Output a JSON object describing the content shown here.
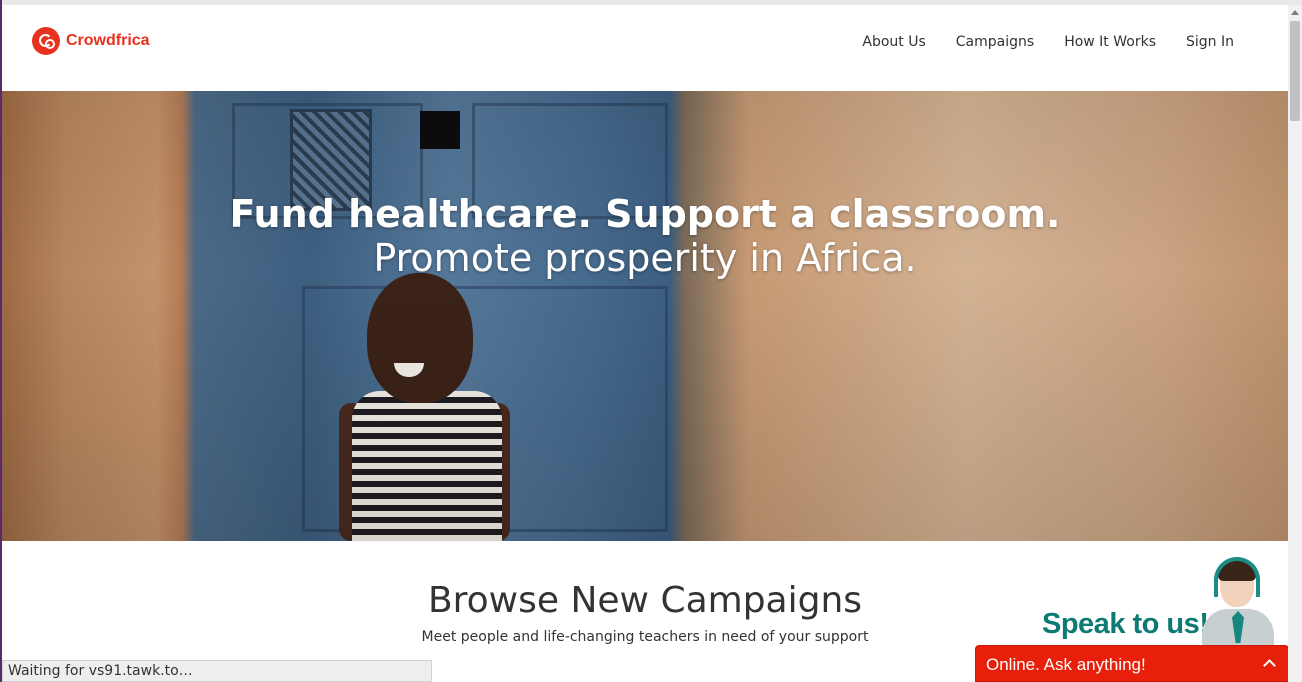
{
  "brand": {
    "name": "Crowdfrica",
    "accent_color": "#e8321f"
  },
  "nav": {
    "items": [
      {
        "label": "About Us"
      },
      {
        "label": "Campaigns"
      },
      {
        "label": "How It Works"
      },
      {
        "label": "Sign In"
      }
    ]
  },
  "hero": {
    "headline": "Fund healthcare. Support a classroom.",
    "subheadline": "Promote prosperity in Africa."
  },
  "campaigns": {
    "title": "Browse New Campaigns",
    "subtitle": "Meet people and life-changing teachers in need of your support"
  },
  "chat": {
    "speak_label": "Speak to us!",
    "bar_label": "Online. Ask anything!",
    "bar_color": "#e8200b"
  },
  "browser": {
    "status_text": "Waiting for vs91.tawk.to…"
  }
}
